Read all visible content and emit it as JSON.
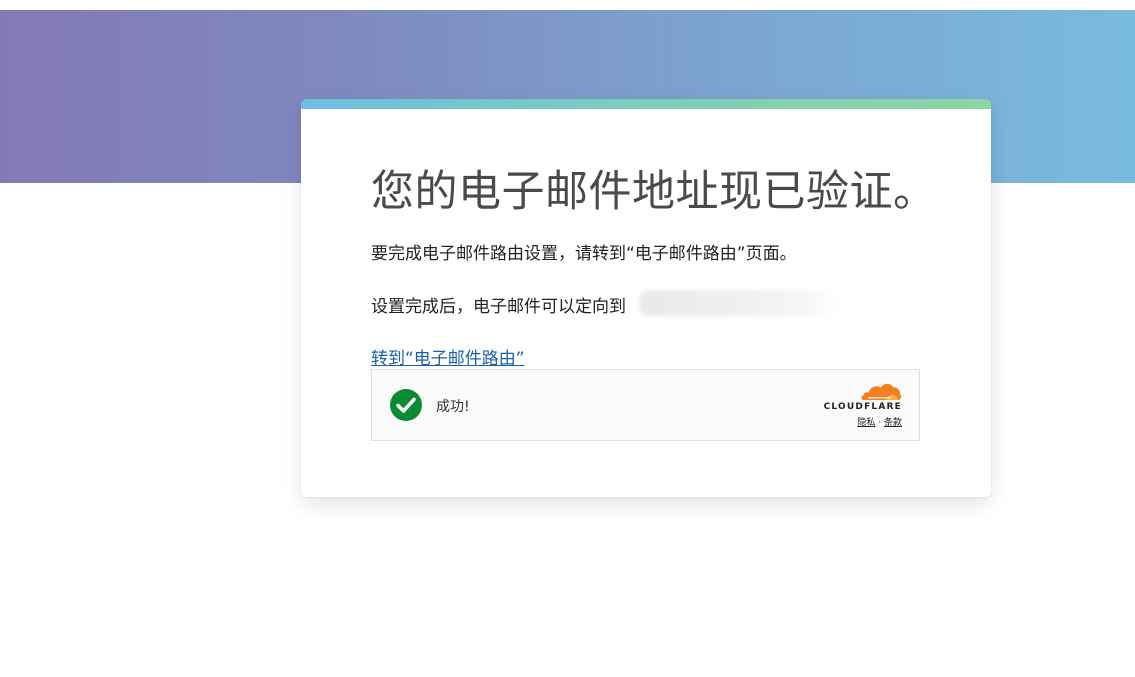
{
  "card": {
    "title": "您的电子邮件地址现已验证。",
    "instruction": "要完成电子邮件路由设置，请转到“电子邮件路由”页面。",
    "forward_text": "设置完成后，电子邮件可以定向到",
    "routing_link_label": "转到“电子邮件路由”"
  },
  "turnstile": {
    "status_text": "成功!",
    "brand": "CLOUDFLARE",
    "privacy_label": "隐私",
    "separator": "·",
    "terms_label": "条款"
  },
  "colors": {
    "hero_gradient_start": "#8479b8",
    "hero_gradient_end": "#79bbdf",
    "accent_gradient_start": "#6bbfe0",
    "accent_gradient_end": "#8cd6a3",
    "link": "#1a5fb4",
    "success_green": "#0a8a33",
    "cloudflare_orange": "#f38020"
  },
  "icons": {
    "success": "checkmark-circle-icon",
    "brand": "cloudflare-cloud-icon"
  }
}
